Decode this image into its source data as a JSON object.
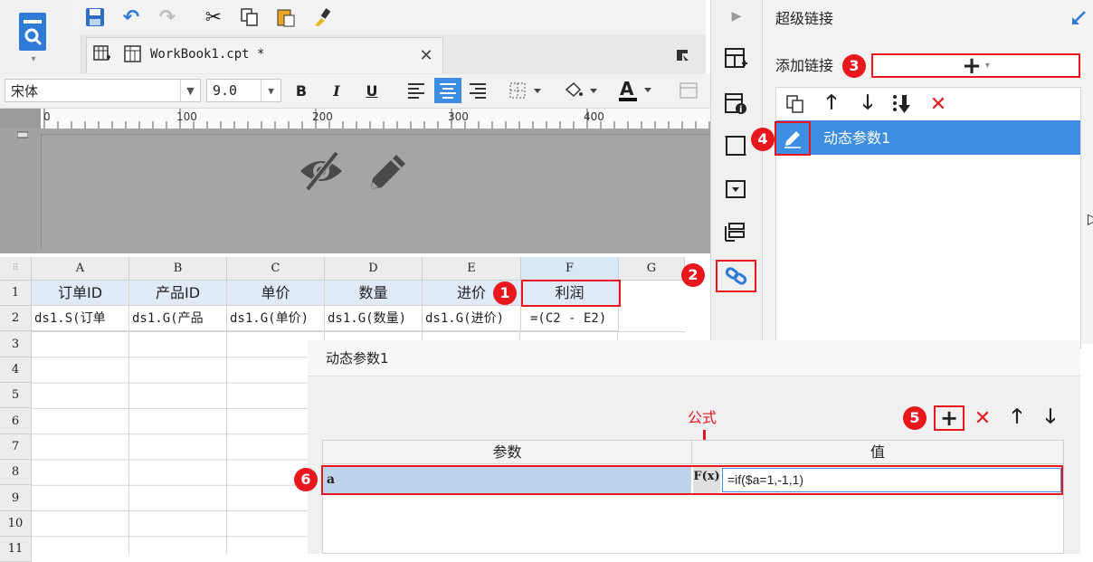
{
  "toolbar": {
    "doc_tab": "WorkBook1.cpt *"
  },
  "font": {
    "family": "宋体",
    "size": "9.0"
  },
  "ruler": {
    "ticks": [
      "0",
      "100",
      "200",
      "300",
      "400"
    ]
  },
  "sheet": {
    "columns": [
      "A",
      "B",
      "C",
      "D",
      "E",
      "F",
      "G"
    ],
    "rows": [
      "1",
      "2",
      "3",
      "4",
      "5",
      "6",
      "7",
      "8",
      "9",
      "10",
      "11"
    ],
    "header_row": [
      "订单ID",
      "产品ID",
      "单价",
      "数量",
      "进价",
      "利润"
    ],
    "data_row": [
      "ds1.S(订单",
      "ds1.G(产品",
      "ds1.G(单价)",
      "ds1.G(数量)",
      "ds1.G(进价)",
      "=(C2 - E2)"
    ]
  },
  "right_panel": {
    "title": "超级链接",
    "add_link_label": "添加链接",
    "add_btn": "+",
    "link_items": [
      "动态参数1"
    ]
  },
  "dialog": {
    "title": "动态参数1",
    "formula_annotation": "公式",
    "col_param": "参数",
    "col_value": "值",
    "param_rows": [
      {
        "name": "a",
        "value": "=if($a=1,-1,1)"
      }
    ],
    "fx_label": "F(x)"
  },
  "badges": [
    "1",
    "2",
    "3",
    "4",
    "5",
    "6"
  ],
  "colors": {
    "accent_red": "#e8171d",
    "select_blue": "#3d8ee3",
    "header_blue": "#dfeaf6",
    "icon_blue": "#2d7bd6"
  }
}
